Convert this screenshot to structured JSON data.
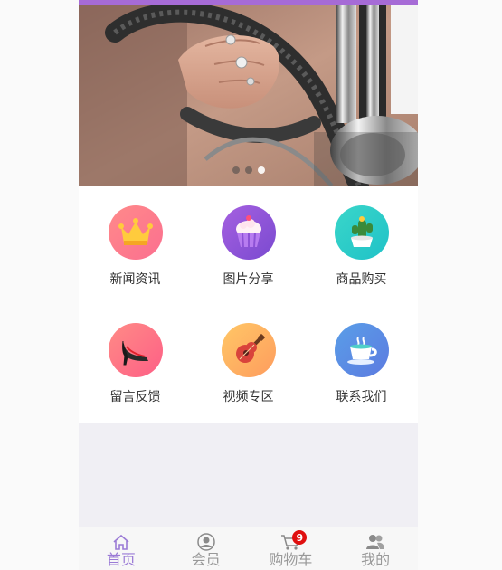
{
  "banner": {
    "image": "steering-wheel-photo",
    "dots_count": 3,
    "active_dot": 2
  },
  "menu": {
    "items": [
      {
        "label": "新闻资讯",
        "icon": "crown-icon",
        "color_from": "#ff8a8a",
        "color_to": "#fb6f8f"
      },
      {
        "label": "图片分享",
        "icon": "cupcake-icon",
        "color_from": "#a560e0",
        "color_to": "#7a4ad0"
      },
      {
        "label": "商品购买",
        "icon": "cactus-icon",
        "color_from": "#3ad6c9",
        "color_to": "#1fc2c8"
      },
      {
        "label": "留言反馈",
        "icon": "high-heel-icon",
        "color_from": "#ff8b86",
        "color_to": "#fd5f86"
      },
      {
        "label": "视频专区",
        "icon": "guitar-icon",
        "color_from": "#ffc766",
        "color_to": "#fe9c5e"
      },
      {
        "label": "联系我们",
        "icon": "coffee-cup-icon",
        "color_from": "#5a9ee8",
        "color_to": "#5c7be0"
      }
    ]
  },
  "tabbar": {
    "items": [
      {
        "label": "首页",
        "icon": "home-icon",
        "active": true
      },
      {
        "label": "会员",
        "icon": "user-icon",
        "active": false
      },
      {
        "label": "购物车",
        "icon": "cart-icon",
        "active": false,
        "badge": "9"
      },
      {
        "label": "我的",
        "icon": "people-icon",
        "active": false
      }
    ]
  },
  "colors": {
    "accent": "#9b7bd6",
    "topbar": "#a66bd6",
    "badge": "#e01010"
  }
}
